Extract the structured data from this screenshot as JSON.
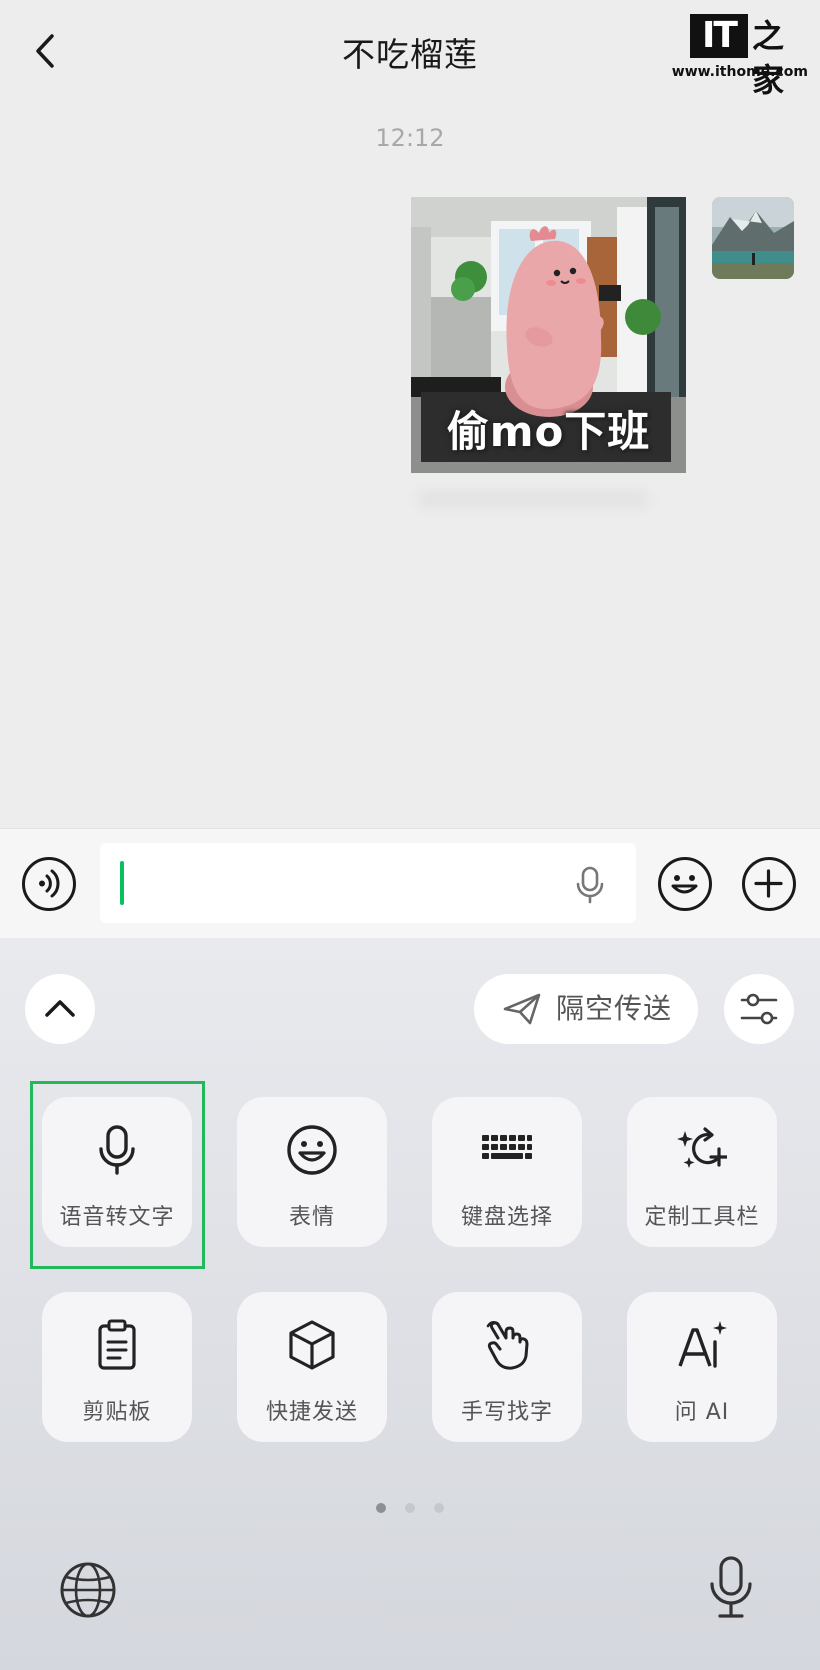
{
  "header": {
    "back_icon": "chevron-left-icon",
    "title": "不吃榴莲"
  },
  "watermark": {
    "logo_text": "IT",
    "logo_cn": "之家",
    "url": "www.ithome.com"
  },
  "chat": {
    "timestamp": "12:12",
    "message": {
      "type": "sticker",
      "caption": "偷mo下班"
    },
    "avatar_icon": "user-avatar"
  },
  "input_bar": {
    "voice_icon": "voice-message-icon",
    "text_value": "",
    "mic_icon": "microphone-icon",
    "emoji_icon": "emoji-icon",
    "plus_icon": "plus-icon"
  },
  "keyboard": {
    "collapse_icon": "chevron-up-icon",
    "airdrop_label": "隔空传送",
    "airdrop_icon": "paper-plane-icon",
    "settings_icon": "sliders-icon",
    "tools": [
      {
        "label": "语音转文字",
        "icon": "microphone-icon",
        "highlighted": true
      },
      {
        "label": "表情",
        "icon": "emoji-icon"
      },
      {
        "label": "键盘选择",
        "icon": "keyboard-icon"
      },
      {
        "label": "定制工具栏",
        "icon": "customize-toolbar-icon"
      },
      {
        "label": "剪贴板",
        "icon": "clipboard-icon"
      },
      {
        "label": "快捷发送",
        "icon": "cube-icon"
      },
      {
        "label": "手写找字",
        "icon": "handwriting-icon"
      },
      {
        "label": "问 AI",
        "icon": "ai-sparkle-icon"
      }
    ],
    "page_count": 3,
    "page_active": 1,
    "globe_icon": "globe-icon",
    "bottom_mic_icon": "microphone-icon"
  },
  "colors": {
    "accent_green": "#07c160",
    "highlight_green": "#22b85c",
    "chat_bg": "#ededed"
  }
}
